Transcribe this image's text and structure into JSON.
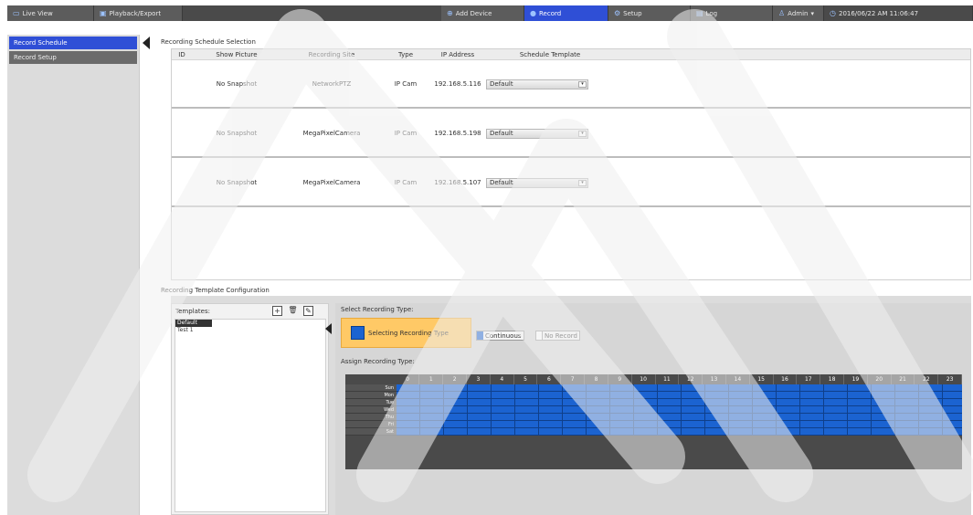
{
  "topbar": {
    "tabs": [
      {
        "label": "Live View",
        "icon": "monitor-icon",
        "active": false
      },
      {
        "label": "Playback/Export",
        "icon": "playback-icon",
        "active": false
      },
      {
        "label": "Add Device",
        "icon": "add-device-icon",
        "active": false
      },
      {
        "label": "Record",
        "icon": "record-icon",
        "active": true
      },
      {
        "label": "Setup",
        "icon": "gear-icon",
        "active": false
      },
      {
        "label": "Log",
        "icon": "log-icon",
        "active": false
      }
    ],
    "user": "Admin",
    "datetime": "2016/06/22 AM 11:06:47"
  },
  "sidebar": {
    "items": [
      {
        "label": "Record Schedule",
        "active": true
      },
      {
        "label": "Record Setup",
        "active": false
      }
    ]
  },
  "schedule": {
    "title": "Recording Schedule Selection",
    "columns": [
      "ID",
      "Show Picture",
      "Recording Site",
      "Type",
      "IP Address",
      "Schedule Template"
    ],
    "rows": [
      {
        "snapshot": "No Snapshot",
        "site": "NetworkPTZ",
        "type": "IP Cam",
        "ip": "192.168.5.116",
        "template": "Default"
      },
      {
        "snapshot": "No Snapshot",
        "site": "MegaPixelCamera",
        "type": "IP Cam",
        "ip": "192.168.5.198",
        "template": "Default"
      },
      {
        "snapshot": "No Snapshot",
        "site": "MegaPixelCamera",
        "type": "IP Cam",
        "ip": "192.168.5.107",
        "template": "Default"
      }
    ]
  },
  "config": {
    "title": "Recording Template Configuration",
    "templates_label": "Templates:",
    "templates": [
      "Default",
      "Test 1"
    ],
    "select_type_title": "Select Recording Type:",
    "selecting_label": "Selecting Recording Type",
    "continuous_label": "Continuous",
    "no_record_label": "No Record",
    "assign_title": "Assign Recording Type:",
    "hours": [
      "0",
      "1",
      "2",
      "3",
      "4",
      "5",
      "6",
      "7",
      "8",
      "9",
      "10",
      "11",
      "12",
      "13",
      "14",
      "15",
      "16",
      "17",
      "18",
      "19",
      "20",
      "21",
      "22",
      "23"
    ],
    "days": [
      "Sun",
      "Mon",
      "Tue",
      "Wed",
      "Thu",
      "Fri",
      "Sat"
    ],
    "colors": {
      "continuous": "#1b63d1",
      "selecting": "#ffc966",
      "active_tab": "#2f4fd6"
    }
  }
}
